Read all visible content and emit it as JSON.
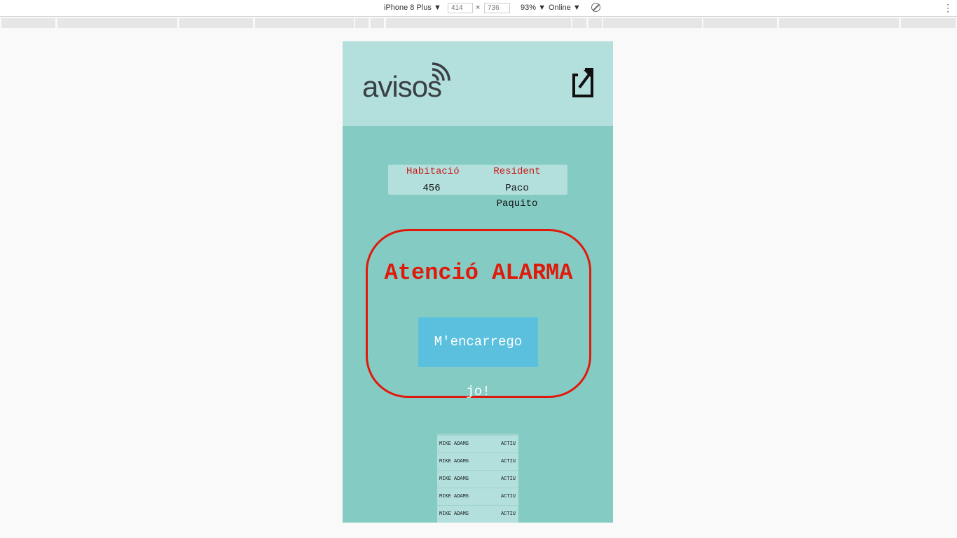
{
  "devtools": {
    "device": "iPhone 8 Plus",
    "width": "414",
    "times": "×",
    "height": "736",
    "zoom": "93%",
    "network": "Online",
    "menu": "⋮"
  },
  "app": {
    "logo_text": "avisos",
    "colors": {
      "header_bg": "#b3dfdc",
      "body_bg": "#84cbc3",
      "alarm_red": "#e0190b",
      "button_blue": "#5bc0de"
    }
  },
  "info": {
    "room_label": "Habitació",
    "room_value": "456",
    "resident_label": "Resident",
    "resident_value": "Paco Paquito"
  },
  "alarm": {
    "title": "Atenció ALARMA",
    "button_label": "M'encarrego jo!"
  },
  "staff": [
    {
      "name": "MIKE ADAMS",
      "status": "ACTIU"
    },
    {
      "name": "MIKE ADAMS",
      "status": "ACTIU"
    },
    {
      "name": "MIKE ADAMS",
      "status": "ACTIU"
    },
    {
      "name": "MIKE ADAMS",
      "status": "ACTIU"
    },
    {
      "name": "MIKE ADAMS",
      "status": "ACTIU"
    }
  ],
  "icons": {
    "logo": "wifi-signal-icon",
    "exit": "external-link-icon"
  }
}
